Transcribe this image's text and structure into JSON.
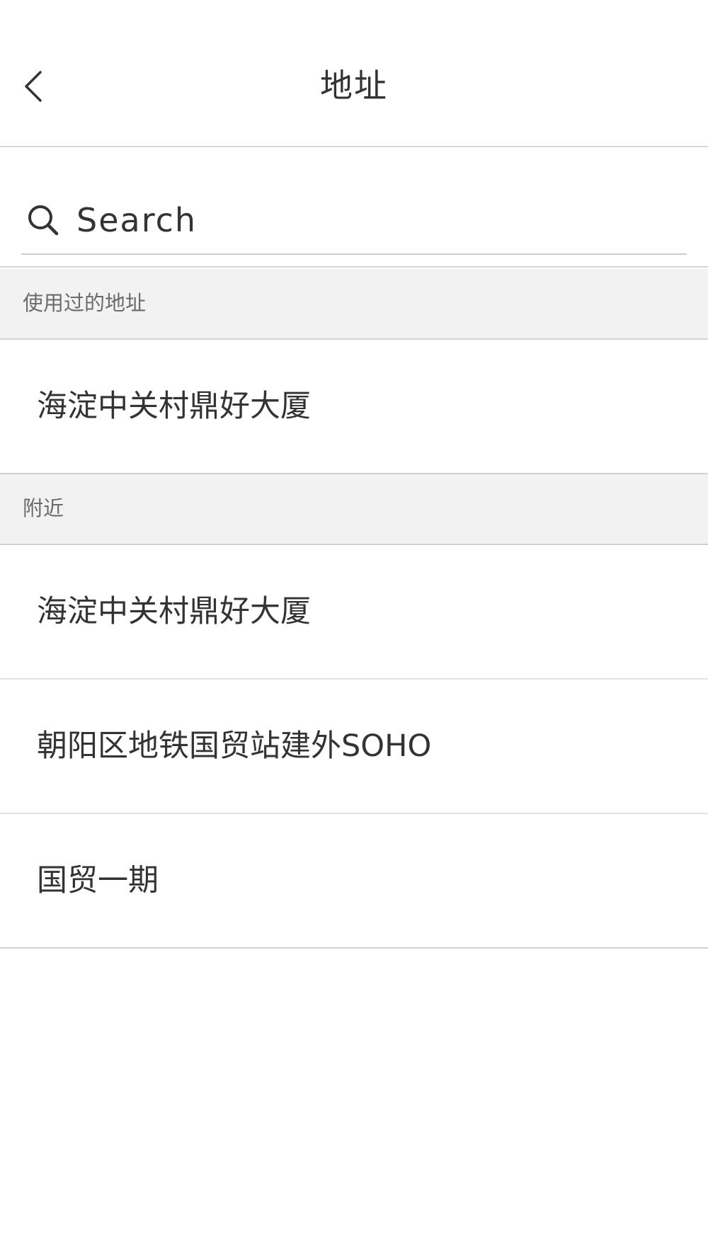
{
  "nav": {
    "title": "地址",
    "back_icon": "chevron-left-icon"
  },
  "search": {
    "placeholder": "Search",
    "icon": "search-icon"
  },
  "sections": {
    "recent": {
      "header": "使用过的地址",
      "items": [
        {
          "label": "海淀中关村鼎好大厦"
        }
      ]
    },
    "nearby": {
      "header": "附近",
      "items": [
        {
          "label": "海淀中关村鼎好大厦"
        },
        {
          "label": "朝阳区地铁国贸站建外SOHO"
        },
        {
          "label": "国贸一期"
        }
      ]
    }
  },
  "colors": {
    "text": "#333333",
    "section_bg": "#f2f2f2",
    "section_text": "#6b6b6b",
    "divider": "#d6d6d6"
  }
}
